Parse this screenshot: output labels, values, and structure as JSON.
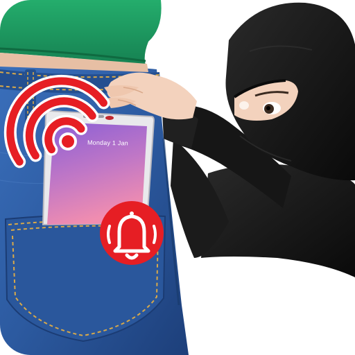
{
  "app_icon": {
    "theme": "anti-theft pocket alarm",
    "colors": {
      "shirt": "#1f9e63",
      "jeans": "#2c5aa0",
      "alarm_red": "#e61e24",
      "phone_screen_top": "#8a5fd6",
      "phone_screen_bottom": "#f08db0",
      "thief_clothing": "#141414",
      "skin": "#f3d2bd",
      "background": "#ffffff"
    },
    "phone": {
      "lockscreen_date": "Monday 1 Jan"
    },
    "icons": [
      "wifi-signal-icon",
      "alarm-bell-icon"
    ]
  }
}
